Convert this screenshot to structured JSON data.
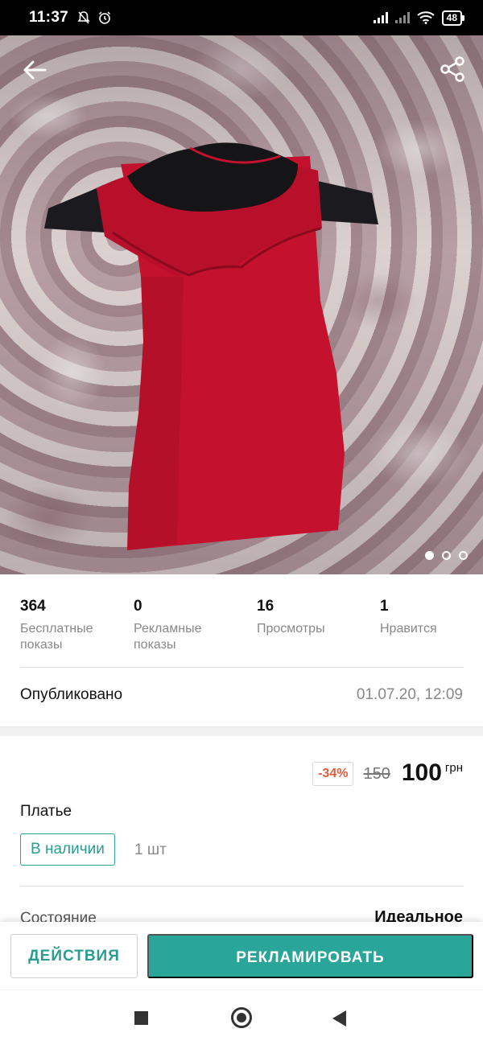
{
  "status_bar": {
    "time": "11:37",
    "battery": "48"
  },
  "photo": {
    "pager": {
      "total": 3,
      "active": 1
    }
  },
  "stats": [
    {
      "value": "364",
      "label_line1": "Бесплатные",
      "label_line2": "показы"
    },
    {
      "value": "0",
      "label_line1": "Рекламные",
      "label_line2": "показы"
    },
    {
      "value": "16",
      "label_line1": "Просмотры",
      "label_line2": ""
    },
    {
      "value": "1",
      "label_line1": "Нравится",
      "label_line2": ""
    }
  ],
  "published": {
    "label": "Опубликовано",
    "date": "01.07.20, 12:09"
  },
  "price": {
    "discount": "-34%",
    "old": "150",
    "new": "100",
    "currency": "грн"
  },
  "item": {
    "title": "Платье",
    "stock_status": "В наличии",
    "quantity": "1 шт"
  },
  "condition": {
    "label": "Состояние",
    "value": "Идеальное"
  },
  "actions": {
    "actions_label": "ДЕЙСТВИЯ",
    "promote_label": "РЕКЛАМИРОВАТЬ"
  },
  "colors": {
    "accent": "#2aa59a",
    "discount": "#e05a3a",
    "status_bar": "#000000"
  }
}
